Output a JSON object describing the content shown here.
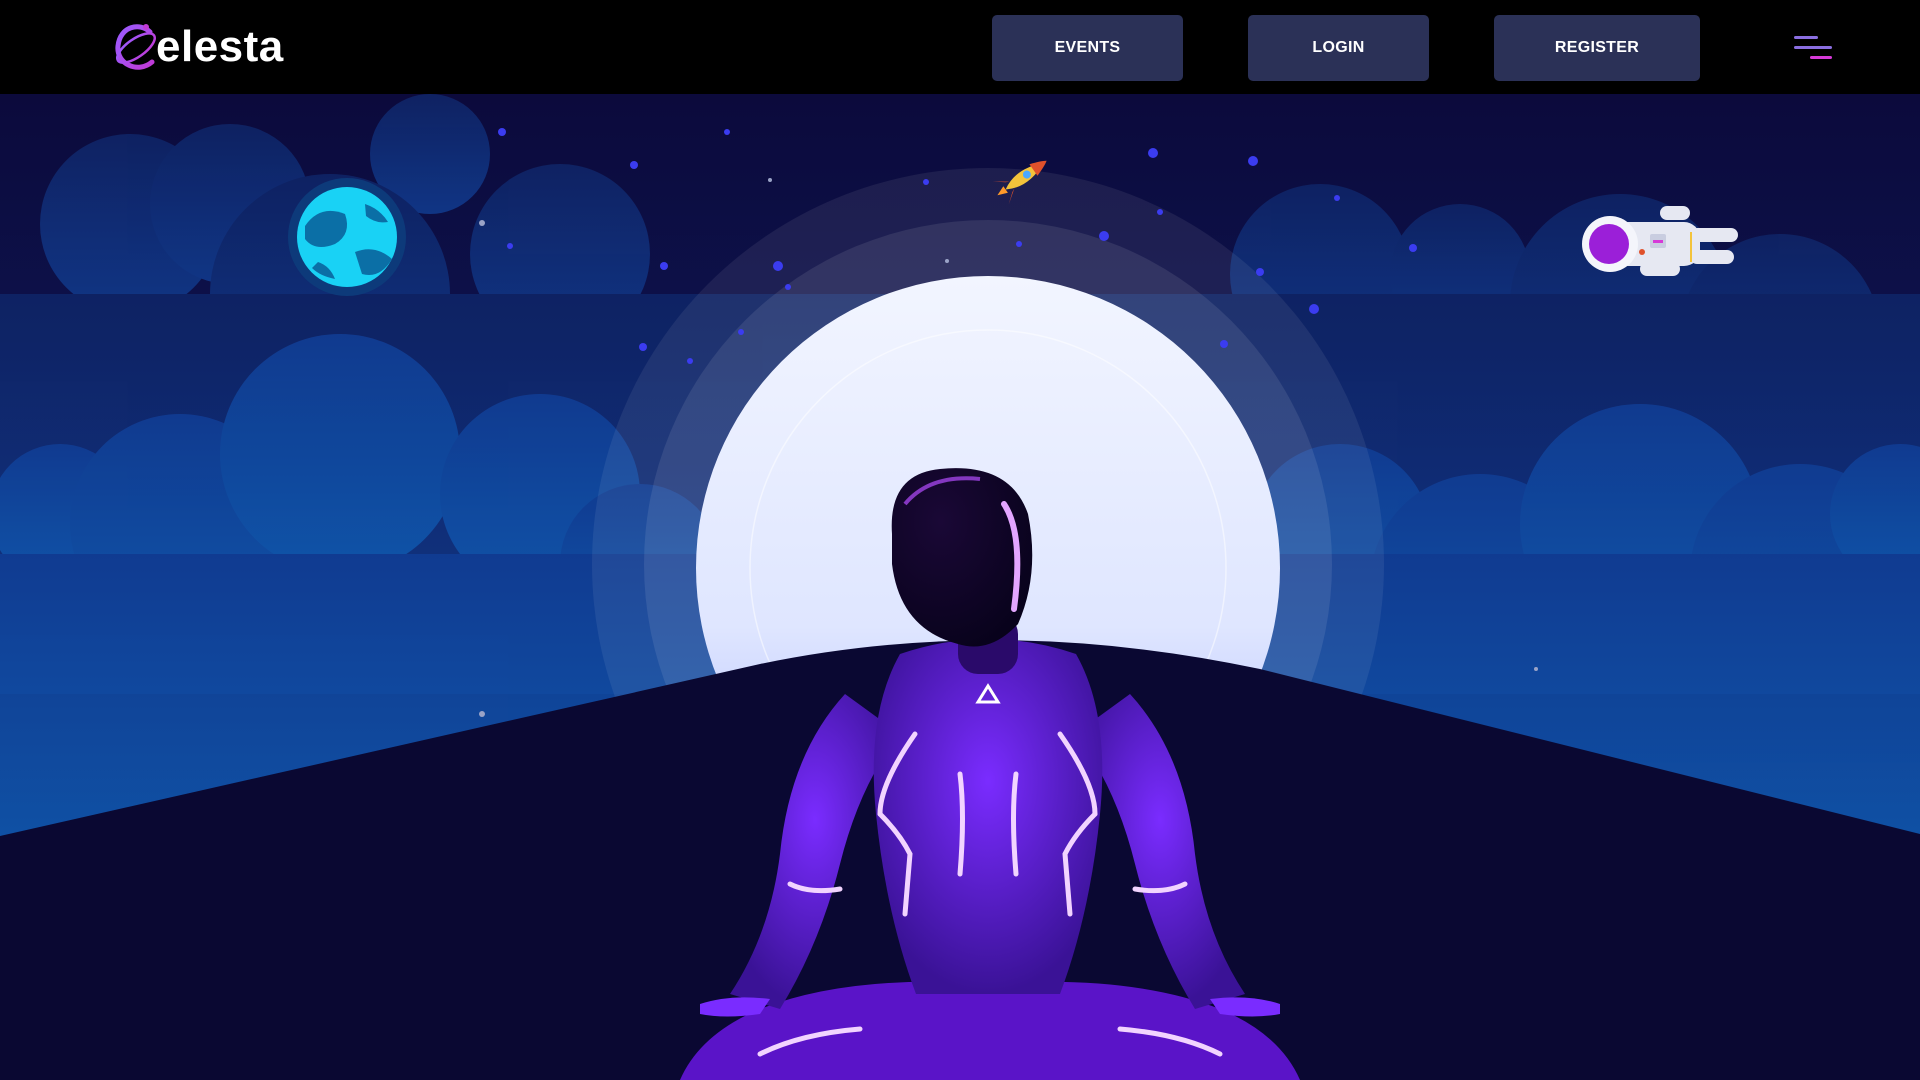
{
  "brand": {
    "logo_text": "elesta",
    "logo_icon": "celesta-orbit-logo-icon"
  },
  "nav": {
    "events_label": "EVENTS",
    "login_label": "LOGIN",
    "register_label": "REGISTER",
    "menu_icon": "hamburger-menu-icon"
  },
  "hero": {
    "illustrations": [
      "planet-icon",
      "rocket-icon",
      "astronaut-icon",
      "moon",
      "meditating-figure"
    ]
  },
  "colors": {
    "navbar_bg": "#000000",
    "button_bg": "#2b3157",
    "sky": "#0c0a3c",
    "moon": "#eef2ff",
    "ground": "#0a0832",
    "neon_purple": "#b44dff",
    "accent_magenta": "#d63ad8"
  }
}
